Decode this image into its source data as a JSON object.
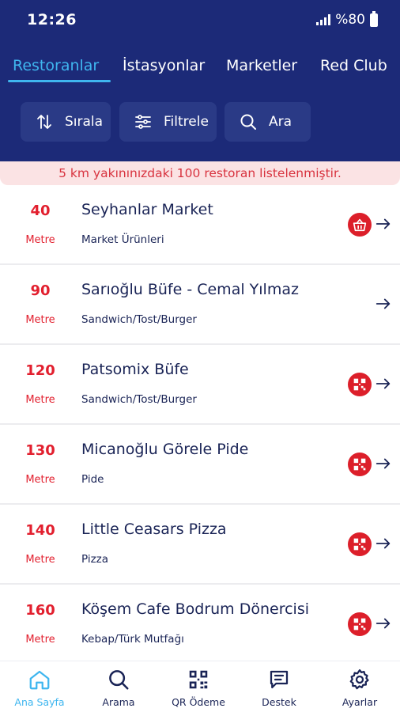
{
  "status_bar": {
    "time": "12:26",
    "battery": "%80"
  },
  "tabs": [
    {
      "label": "Restoranlar",
      "active": true
    },
    {
      "label": "İstasyonlar",
      "active": false
    },
    {
      "label": "Marketler",
      "active": false
    },
    {
      "label": "Red Club",
      "active": false
    }
  ],
  "toolbar": {
    "sort_label": "Sırala",
    "filter_label": "Filtrele",
    "search_label": "Ara"
  },
  "notice": "5 km yakınınızdaki 100 restoran listelenmiştir.",
  "places": [
    {
      "distance": "40",
      "unit": "Metre",
      "name": "Seyhanlar Market",
      "category": "Market Ürünleri",
      "badge": "basket-icon"
    },
    {
      "distance": "90",
      "unit": "Metre",
      "name": "Sarıoğlu Büfe - Cemal Yılmaz",
      "category": "Sandwich/Tost/Burger",
      "badge": ""
    },
    {
      "distance": "120",
      "unit": "Metre",
      "name": "Patsomix Büfe",
      "category": "Sandwich/Tost/Burger",
      "badge": "qr-icon"
    },
    {
      "distance": "130",
      "unit": "Metre",
      "name": "Micanoğlu Görele Pide",
      "category": "Pide",
      "badge": "qr-icon"
    },
    {
      "distance": "140",
      "unit": "Metre",
      "name": "Little Ceasars Pizza",
      "category": "Pizza",
      "badge": "qr-icon"
    },
    {
      "distance": "160",
      "unit": "Metre",
      "name": "Köşem Cafe Bodrum Dönercisi",
      "category": "Kebap/Türk Mutfağı",
      "badge": "qr-icon"
    }
  ],
  "bottom_nav": [
    {
      "label": "Ana Sayfa",
      "icon": "home-icon",
      "active": true
    },
    {
      "label": "Arama",
      "icon": "search-icon",
      "active": false
    },
    {
      "label": "QR Ödeme",
      "icon": "qr-code-icon",
      "active": false
    },
    {
      "label": "Destek",
      "icon": "chat-icon",
      "active": false
    },
    {
      "label": "Ayarlar",
      "icon": "gear-icon",
      "active": false
    }
  ],
  "colors": {
    "header_bg": "#1c2a78",
    "accent": "#3fb6ef",
    "distance_red": "#e21f2e",
    "notice_bg": "#fbe3e4"
  }
}
